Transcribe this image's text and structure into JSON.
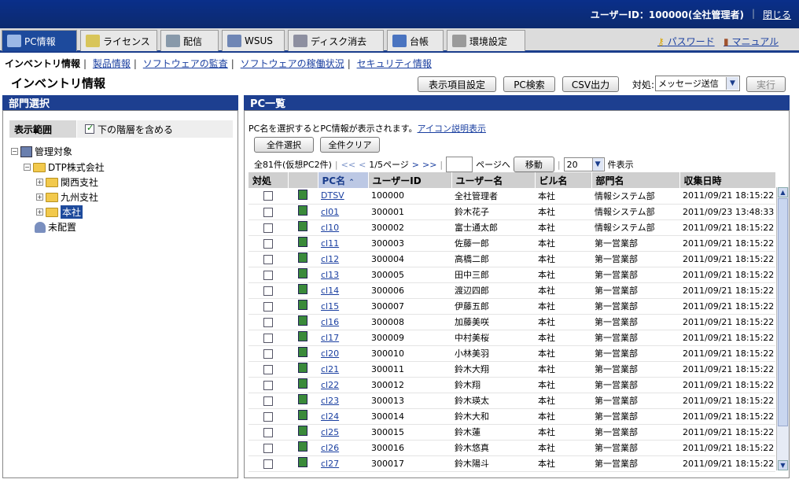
{
  "header": {
    "user_info": "ユーザーID：100000(全社管理者)",
    "logout": "閉じる"
  },
  "tabs": [
    {
      "label": "PC情報",
      "icon": "pc-info-icon"
    },
    {
      "label": "ライセンス",
      "icon": "license-icon"
    },
    {
      "label": "配信",
      "icon": "distribution-icon"
    },
    {
      "label": "WSUS",
      "icon": "wsus-icon"
    },
    {
      "label": "ディスク消去",
      "icon": "disk-erase-icon"
    },
    {
      "label": "台帳",
      "icon": "ledger-icon"
    },
    {
      "label": "環境設定",
      "icon": "settings-icon"
    }
  ],
  "top_links": {
    "password": "パスワード",
    "manual": "マニュアル"
  },
  "subnav": {
    "current": "インベントリ情報",
    "links": [
      "製品情報",
      "ソフトウェアの監査",
      "ソフトウェアの稼働状況",
      "セキュリティ情報"
    ]
  },
  "page_title": "インベントリ情報",
  "toolbar": {
    "columns_button": "表示項目設定",
    "pc_search_button": "PC検索",
    "csv_button": "CSV出力",
    "action_label": "対処:",
    "action_select": "メッセージ送信",
    "execute_button": "実行"
  },
  "left_panel": {
    "title": "部門選択",
    "range_label": "表示範囲",
    "include_sub_label": "下の階層を含める",
    "tree": {
      "root": "管理対象",
      "company": "DTP株式会社",
      "branches": [
        "関西支社",
        "九州支社",
        "本社"
      ],
      "unassigned": "未配置"
    }
  },
  "right_panel": {
    "title": "PC一覧",
    "message": "PC名を選択するとPC情報が表示されます。",
    "icon_help_link": "アイコン説明表示",
    "select_all": "全件選択",
    "clear_all": "全件クリア",
    "count_text": "全81件(仮想PC2件)",
    "page_text": "1/5ページ",
    "page_to": "ページへ",
    "move_button": "移動",
    "per_page_value": "20",
    "per_page_suffix": "件表示",
    "columns": [
      "対処",
      "",
      "PC名",
      "ユーザーID",
      "ユーザー名",
      "ビル名",
      "部門名",
      "収集日時"
    ],
    "rows": [
      {
        "pc": "DTSV",
        "uid": "100000",
        "uname": "全社管理者",
        "bldg": "本社",
        "dept": "情報システム部",
        "date": "2011/09/21 18:15:22"
      },
      {
        "pc": "cl01",
        "uid": "300001",
        "uname": "鈴木花子",
        "bldg": "本社",
        "dept": "情報システム部",
        "date": "2011/09/23 13:48:33"
      },
      {
        "pc": "cl10",
        "uid": "300002",
        "uname": "富士通太郎",
        "bldg": "本社",
        "dept": "情報システム部",
        "date": "2011/09/21 18:15:22"
      },
      {
        "pc": "cl11",
        "uid": "300003",
        "uname": "佐藤一郎",
        "bldg": "本社",
        "dept": "第一営業部",
        "date": "2011/09/21 18:15:22"
      },
      {
        "pc": "cl12",
        "uid": "300004",
        "uname": "高橋二郎",
        "bldg": "本社",
        "dept": "第一営業部",
        "date": "2011/09/21 18:15:22"
      },
      {
        "pc": "cl13",
        "uid": "300005",
        "uname": "田中三郎",
        "bldg": "本社",
        "dept": "第一営業部",
        "date": "2011/09/21 18:15:22"
      },
      {
        "pc": "cl14",
        "uid": "300006",
        "uname": "渡辺四郎",
        "bldg": "本社",
        "dept": "第一営業部",
        "date": "2011/09/21 18:15:22"
      },
      {
        "pc": "cl15",
        "uid": "300007",
        "uname": "伊藤五郎",
        "bldg": "本社",
        "dept": "第一営業部",
        "date": "2011/09/21 18:15:22"
      },
      {
        "pc": "cl16",
        "uid": "300008",
        "uname": "加藤美咲",
        "bldg": "本社",
        "dept": "第一営業部",
        "date": "2011/09/21 18:15:22"
      },
      {
        "pc": "cl17",
        "uid": "300009",
        "uname": "中村美桜",
        "bldg": "本社",
        "dept": "第一営業部",
        "date": "2011/09/21 18:15:22"
      },
      {
        "pc": "cl20",
        "uid": "300010",
        "uname": "小林美羽",
        "bldg": "本社",
        "dept": "第一営業部",
        "date": "2011/09/21 18:15:22"
      },
      {
        "pc": "cl21",
        "uid": "300011",
        "uname": "鈴木大翔",
        "bldg": "本社",
        "dept": "第一営業部",
        "date": "2011/09/21 18:15:22"
      },
      {
        "pc": "cl22",
        "uid": "300012",
        "uname": "鈴木翔",
        "bldg": "本社",
        "dept": "第一営業部",
        "date": "2011/09/21 18:15:22"
      },
      {
        "pc": "cl23",
        "uid": "300013",
        "uname": "鈴木瑛太",
        "bldg": "本社",
        "dept": "第一営業部",
        "date": "2011/09/21 18:15:22"
      },
      {
        "pc": "cl24",
        "uid": "300014",
        "uname": "鈴木大和",
        "bldg": "本社",
        "dept": "第一営業部",
        "date": "2011/09/21 18:15:22"
      },
      {
        "pc": "cl25",
        "uid": "300015",
        "uname": "鈴木蓮",
        "bldg": "本社",
        "dept": "第一営業部",
        "date": "2011/09/21 18:15:22"
      },
      {
        "pc": "cl26",
        "uid": "300016",
        "uname": "鈴木悠真",
        "bldg": "本社",
        "dept": "第一営業部",
        "date": "2011/09/21 18:15:22"
      },
      {
        "pc": "cl27",
        "uid": "300017",
        "uname": "鈴木陽斗",
        "bldg": "本社",
        "dept": "第一営業部",
        "date": "2011/09/21 18:15:22"
      }
    ]
  }
}
